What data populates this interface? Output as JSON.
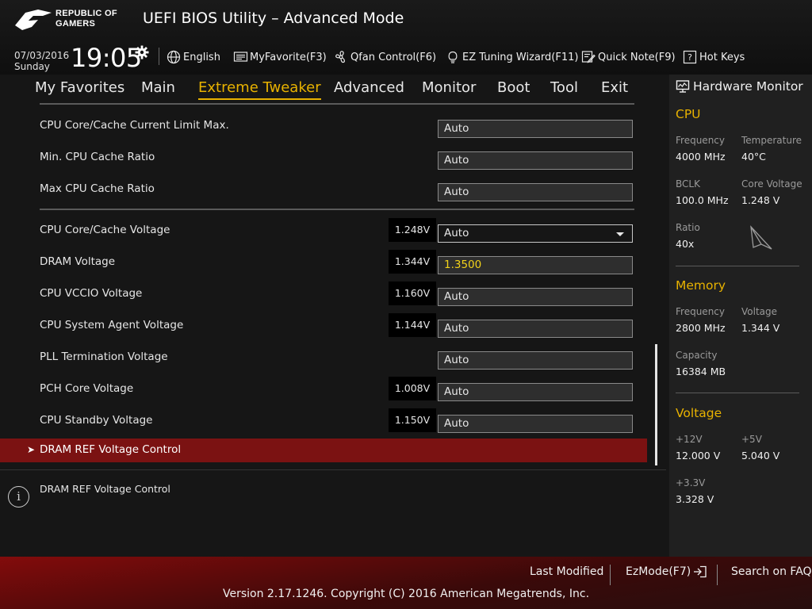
{
  "header": {
    "logo_line1": "REPUBLIC OF",
    "logo_line2": "GAMERS",
    "title": "UEFI BIOS Utility – Advanced Mode",
    "date": "07/03/2016",
    "day": "Sunday",
    "time": "19:05",
    "language": "English",
    "my_favorite": "MyFavorite(F3)",
    "qfan": "Qfan Control(F6)",
    "ez_tuning": "EZ Tuning Wizard(F11)",
    "quick_note": "Quick Note(F9)",
    "hot_keys": "Hot Keys"
  },
  "tabs": [
    "My Favorites",
    "Main",
    "Extreme Tweaker",
    "Advanced",
    "Monitor",
    "Boot",
    "Tool",
    "Exit"
  ],
  "active_tab": "Extreme Tweaker",
  "settings": [
    {
      "label": "CPU Core/Cache Current Limit Max.",
      "voltage": "",
      "value": "Auto"
    },
    {
      "label": "Min. CPU Cache Ratio",
      "voltage": "",
      "value": "Auto"
    },
    {
      "label": "Max CPU Cache Ratio",
      "voltage": "",
      "value": "Auto"
    },
    {
      "label": "CPU Core/Cache Voltage",
      "voltage": "1.248V",
      "value": "Auto"
    },
    {
      "label": "DRAM Voltage",
      "voltage": "1.344V",
      "value": "1.3500"
    },
    {
      "label": "CPU VCCIO Voltage",
      "voltage": "1.160V",
      "value": "Auto"
    },
    {
      "label": "CPU System Agent Voltage",
      "voltage": "1.144V",
      "value": "Auto"
    },
    {
      "label": "PLL Termination Voltage",
      "voltage": "",
      "value": "Auto"
    },
    {
      "label": "PCH Core Voltage",
      "voltage": "1.008V",
      "value": "Auto"
    },
    {
      "label": "CPU Standby Voltage",
      "voltage": "1.150V",
      "value": "Auto"
    }
  ],
  "submenu": {
    "arrow": "➤",
    "label": "DRAM REF Voltage Control"
  },
  "help": {
    "icon": "i",
    "text": "DRAM REF Voltage Control"
  },
  "hardware_monitor": {
    "title": "Hardware Monitor",
    "cpu": {
      "title": "CPU",
      "frequency_label": "Frequency",
      "frequency": "4000 MHz",
      "temperature_label": "Temperature",
      "temperature": "40°C",
      "bclk_label": "BCLK",
      "bclk": "100.0 MHz",
      "core_voltage_label": "Core Voltage",
      "core_voltage": "1.248 V",
      "ratio_label": "Ratio",
      "ratio": "40x"
    },
    "memory": {
      "title": "Memory",
      "frequency_label": "Frequency",
      "frequency": "2800 MHz",
      "voltage_label": "Voltage",
      "voltage": "1.344 V",
      "capacity_label": "Capacity",
      "capacity": "16384 MB"
    },
    "voltage": {
      "title": "Voltage",
      "v12_label": "+12V",
      "v12": "12.000 V",
      "v5_label": "+5V",
      "v5": "5.040 V",
      "v33_label": "+3.3V",
      "v33": "3.328 V"
    }
  },
  "footer": {
    "last_modified": "Last Modified",
    "ez_mode": "EzMode(F7)",
    "search_faq": "Search on FAQ",
    "copyright": "Version 2.17.1246. Copyright (C) 2016 American Megatrends, Inc."
  },
  "colors": {
    "accent": "#e8b200",
    "highlight_row": "#7b1212",
    "yellow_value": "#f2d21a"
  }
}
